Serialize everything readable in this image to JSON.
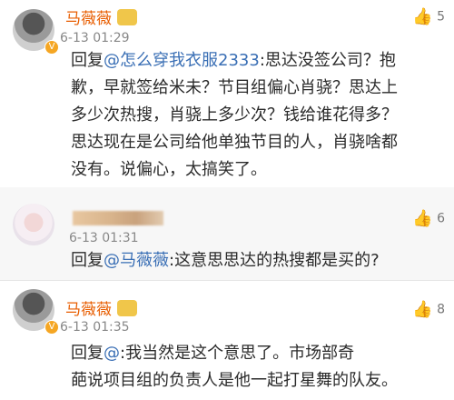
{
  "comments": [
    {
      "name": "马薇薇",
      "time": "6-13 01:29",
      "likes": "5",
      "reply_prefix": "回复",
      "mention": "@怎么穿我衣服2333",
      "body": ":思达没签公司？抱\n歉，早就签给米未？节目组偏心肖骁？思达上\n多少次热搜，肖骁上多少次？钱给谁花得多？\n思达现在是公司给他单独节目的人，肖骁啥都\n没有。说偏心，太搞笑了。"
    },
    {
      "name": "",
      "time": "6-13 01:31",
      "likes": "6",
      "reply_prefix": "回复",
      "mention": "@马薇薇",
      "body": ":这意思思达的热搜都是买的?"
    },
    {
      "name": "马薇薇",
      "time": "6-13 01:35",
      "likes": "8",
      "reply_prefix": "回复",
      "mention": "@",
      "body": ":我当然是这个意思了。市场部奇\n葩说项目组的负责人是他一起打星舞的队友。"
    }
  ]
}
